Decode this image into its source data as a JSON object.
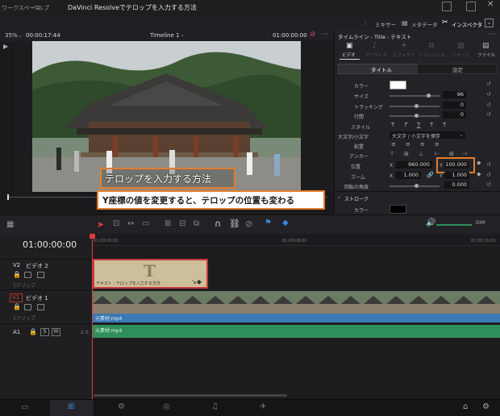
{
  "menu": {
    "workspace": "ワークスペース",
    "help": "ヘルプ",
    "window_title": "DaVinci Resolveでテロップを入力する方法"
  },
  "toolbar": {
    "mixer": "ミキサー",
    "metadata": "メタデータ",
    "inspector": "インスペクタ"
  },
  "viewer": {
    "zoom": "35%",
    "timecode_left": "00:00:17:44",
    "timeline_name": "Timeline 1",
    "timecode_right": "01:00:00:00"
  },
  "title_overlay": "テロップを入力する方法",
  "annotation": "Y座標の値を変更すると、テロップの位置も変わる",
  "inspector": {
    "header": "タイムライン - Title - テキスト",
    "tabs": [
      "ビデオ",
      "オーディオ",
      "エフェクト",
      "トランジション",
      "イメージ",
      "ファイル"
    ],
    "subtabs": [
      "タイトル",
      "設定"
    ],
    "color_label": "カラー",
    "size_label": "サイズ",
    "size_value": "96",
    "tracking_label": "トラッキング",
    "tracking_value": "0",
    "line_spacing_label": "行間",
    "line_spacing_value": "0",
    "style_label": "スタイル",
    "style_options": [
      "T",
      "T",
      "T",
      "T",
      "T"
    ],
    "case_label": "大文字/小文字",
    "case_value": "大文字 / 小文字を保存",
    "align_label": "配置",
    "anchor_label": "アンカー",
    "position_label": "位置",
    "x_label": "X",
    "x_value": "960.000",
    "y_label": "Y",
    "y_value": "100.000",
    "zoom_label": "ズーム",
    "zoom_x_label": "X",
    "zoom_x_value": "1.000",
    "zoom_y_label": "Y",
    "zoom_y_value": "1.000",
    "rotation_label": "回転の角度",
    "rotation_value": "0.000",
    "stroke_label": "ストローク",
    "stroke_color_label": "カラー"
  },
  "timeline": {
    "timecode": "01:00:00:00",
    "ruler": [
      "01:00:00:00",
      "01:00:08:00",
      "01:00:16:00"
    ],
    "tracks": [
      {
        "id": "V2",
        "name": "ビデオ 2",
        "clips_label": "1クリップ"
      },
      {
        "id": "V1",
        "name": "ビデオ 1",
        "clips_label": "1クリップ"
      },
      {
        "id": "A1",
        "name": "",
        "clips_label": ""
      }
    ],
    "title_clip_label": "テキスト - テロップを入力する方法",
    "video_clip_label": "元素材.mp4",
    "audio_clip_label": "元素材.mp4",
    "audio_level": "2.0",
    "mute_label": "M",
    "solo_label": "S"
  },
  "colors": {
    "accent_orange": "#e47d2d",
    "audio_green": "#2f8f5a",
    "video_blue": "#3a7ab3",
    "playhead": "#e23a3a"
  }
}
